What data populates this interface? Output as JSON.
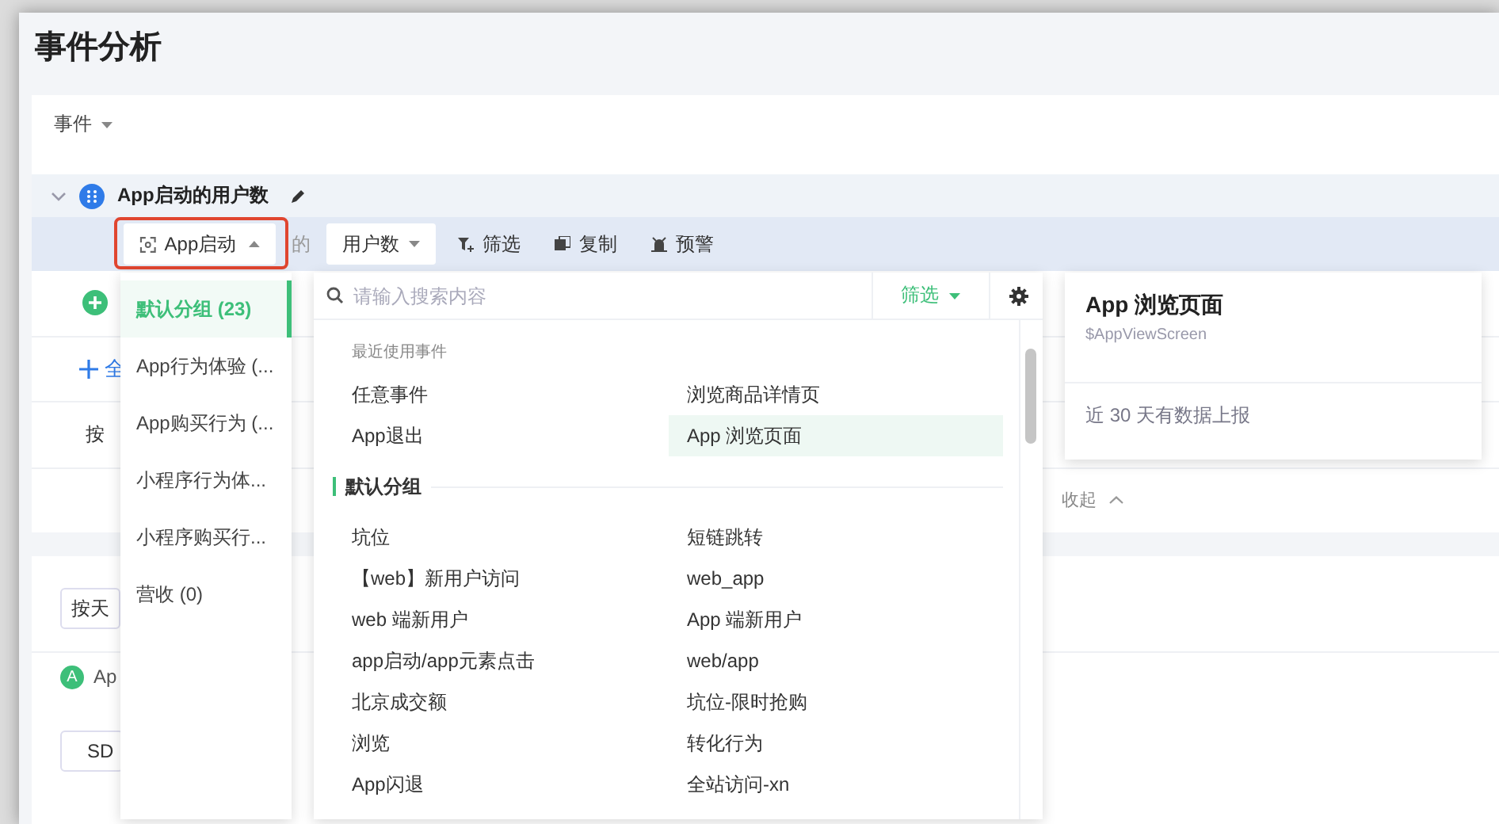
{
  "page": {
    "title": "事件分析"
  },
  "event_selector": {
    "label": "事件"
  },
  "metric": {
    "name": "App启动的用户数",
    "expanded": true
  },
  "toolbar": {
    "event_button": "App启动",
    "connector": "的",
    "aggregate": "用户数",
    "actions": [
      {
        "kind": "filter",
        "label": "筛选"
      },
      {
        "kind": "copy",
        "label": "复制"
      },
      {
        "kind": "alert",
        "label": "预警"
      }
    ]
  },
  "background": {
    "add_partial": "全",
    "group_by_partial": "按",
    "collapse": "收起",
    "granularity": "按天",
    "series_badge": "A",
    "series_partial": "Ap",
    "sdk_partial": "SD"
  },
  "dropdown": {
    "groups": [
      {
        "label": "默认分组 (23)",
        "selected": true
      },
      {
        "label": "App行为体验 (...",
        "selected": false
      },
      {
        "label": "App购买行为 (...",
        "selected": false
      },
      {
        "label": "小程序行为体...",
        "selected": false
      },
      {
        "label": "小程序购买行...",
        "selected": false
      },
      {
        "label": "营收 (0)",
        "selected": false
      }
    ],
    "search": {
      "placeholder": "请输入搜索内容"
    },
    "filter": "筛选",
    "recent": {
      "title": "最近使用事件",
      "items": [
        {
          "label": "任意事件",
          "selected": false
        },
        {
          "label": "浏览商品详情页",
          "selected": false
        },
        {
          "label": "App退出",
          "selected": false
        },
        {
          "label": "App 浏览页面",
          "selected": true
        }
      ]
    },
    "section": {
      "title": "默认分组",
      "items": [
        {
          "label": "坑位",
          "selected": false
        },
        {
          "label": "短链跳转",
          "selected": false
        },
        {
          "label": "【web】新用户访问",
          "selected": false
        },
        {
          "label": "web_app",
          "selected": false
        },
        {
          "label": "web 端新用户",
          "selected": false
        },
        {
          "label": "App 端新用户",
          "selected": false
        },
        {
          "label": "app启动/app元素点击",
          "selected": false
        },
        {
          "label": "web/app",
          "selected": false
        },
        {
          "label": "北京成交额",
          "selected": false
        },
        {
          "label": "坑位-限时抢购",
          "selected": false
        },
        {
          "label": "浏览",
          "selected": false
        },
        {
          "label": "转化行为",
          "selected": false
        },
        {
          "label": "App闪退",
          "selected": false
        },
        {
          "label": "全站访问-xn",
          "selected": false
        }
      ]
    }
  },
  "tooltip": {
    "title": "App 浏览页面",
    "id": "$AppViewScreen",
    "note": "近 30 天有数据上报"
  }
}
